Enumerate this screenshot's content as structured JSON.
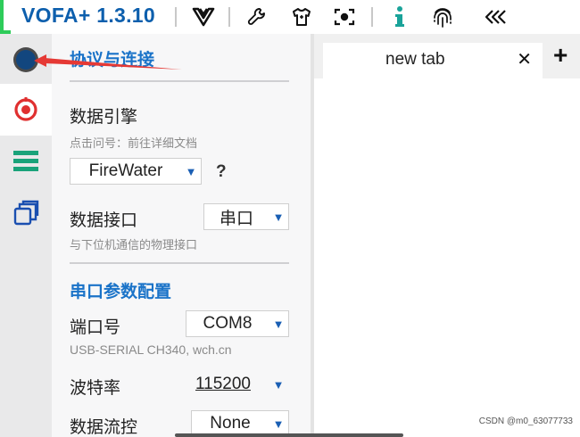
{
  "app": {
    "title": "VOFA+ 1.3.10",
    "toolbar_icons": [
      "vofa-logo-icon",
      "wrench-icon",
      "shirt-icon",
      "screenshot-icon",
      "info-icon",
      "fingerprint-icon",
      "rewind-icon"
    ],
    "accent": "#0d5fad",
    "info_color": "#1aa39a"
  },
  "rail": {
    "items": [
      "connection-dot-icon",
      "record-icon",
      "menu-icon",
      "copy-icon"
    ],
    "active_index": 1
  },
  "panel": {
    "protocol_section": "协议与连接",
    "engine_label": "数据引擎",
    "engine_hint": "点击问号：前往详细文档",
    "engine_value": "FireWater",
    "engine_help": "?",
    "interface_label": "数据接口",
    "interface_value": "串口",
    "interface_hint": "与下位机通信的物理接口",
    "serial_section": "串口参数配置",
    "port_label": "端口号",
    "port_value": "COM8",
    "port_hint": "USB-SERIAL CH340, wch.cn",
    "baud_label": "波特率",
    "baud_value": "115200",
    "flow_label": "数据流控",
    "flow_value": "None"
  },
  "tabs": {
    "items": [
      {
        "label": "new tab"
      }
    ],
    "close_glyph": "✕",
    "add_glyph": "+"
  },
  "watermark": "CSDN @m0_63077733"
}
